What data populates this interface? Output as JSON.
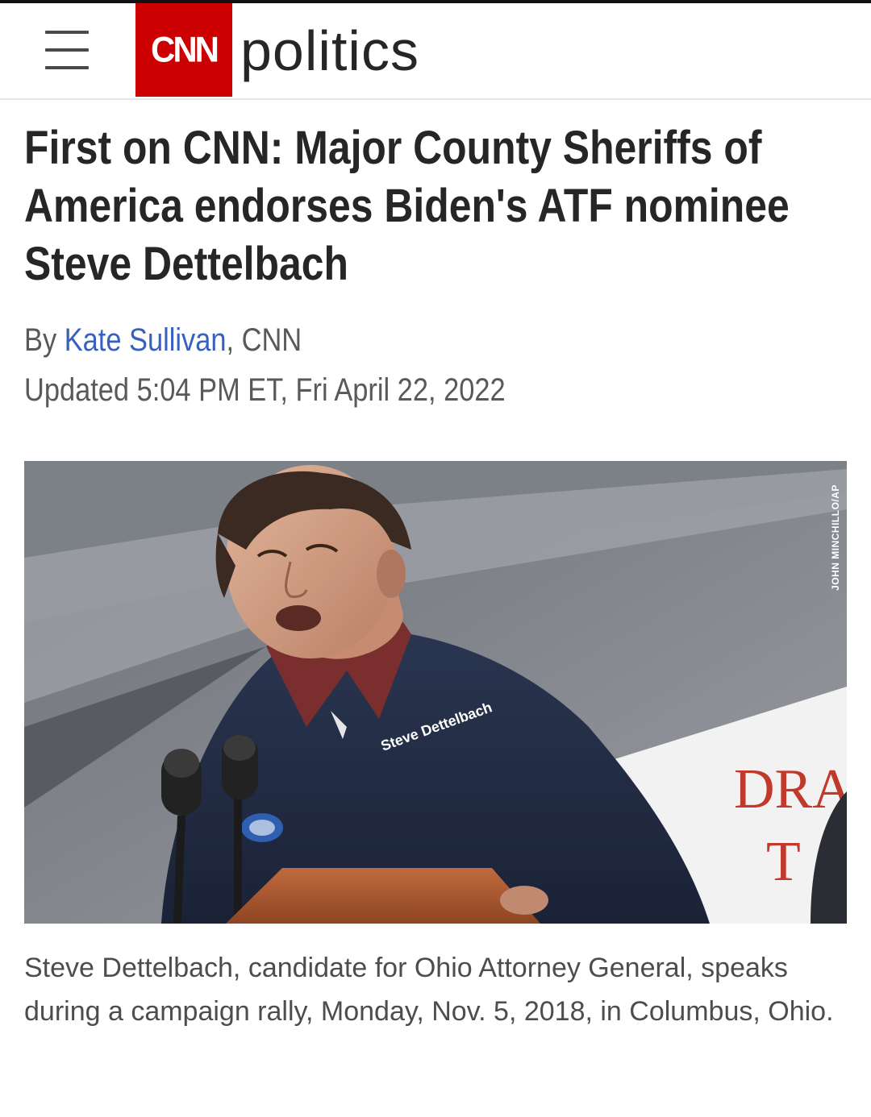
{
  "header": {
    "brand": "CNN",
    "section": "politics",
    "menu_icon": "hamburger-menu-icon",
    "brand_color": "#cc0000"
  },
  "article": {
    "headline": "First on CNN: Major County Sheriffs of America endorses Biden's ATF nominee Steve Dettelbach",
    "byline_prefix": "By ",
    "author": "Kate Sullivan",
    "byline_suffix": ", CNN",
    "updated": "Updated 5:04 PM ET, Fri April 22, 2022",
    "image": {
      "credit": "JOHN MINCHILLO/AP",
      "caption": "Steve Dettelbach, candidate for Ohio Attorney General, speaks during a campaign rally, Monday, Nov. 5, 2018, in Columbus, Ohio.",
      "jacket_text": "Steve Dettelbach",
      "banner_text": "DRA",
      "banner_text_2": "T"
    },
    "author_link_color": "#3860be"
  }
}
